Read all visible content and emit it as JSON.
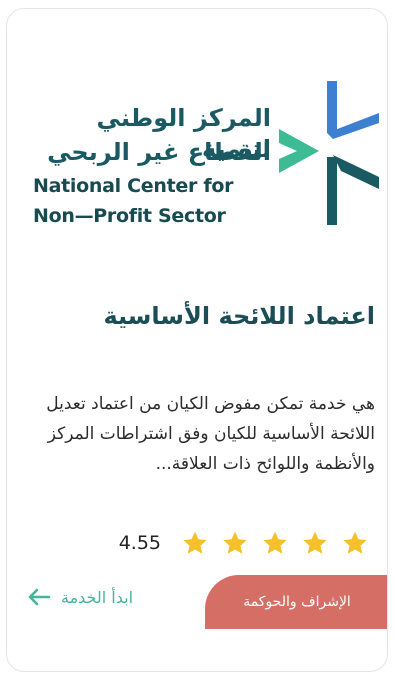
{
  "logo": {
    "ar_line1": "المركز الوطني لتنمية",
    "ar_line2": "القطاع غير الربحي",
    "en_line1": "National Center for",
    "en_line2": "Non—Profit Sector",
    "colors": {
      "teal": "#1a5a63",
      "green": "#3dbb94",
      "blue": "#3d7fd1"
    }
  },
  "service": {
    "title": "اعتماد اللائحة الأساسية",
    "description": "هي خدمة تمكن مفوض الكيان من اعتماد تعديل اللائحة الأساسية للكيان وفق اشتراطات المركز والأنظمة واللوائح ذات العلاقة...",
    "rating": {
      "value": "4.55",
      "stars_filled": 5,
      "stars_total": 5,
      "star_color": "#f4c12a"
    },
    "category": "الإشراف والحوكمة",
    "category_color": "#d56f66",
    "start_label": "ابدأ الخدمة",
    "start_icon": "arrow-left-icon",
    "accent_color": "#45b59a"
  }
}
